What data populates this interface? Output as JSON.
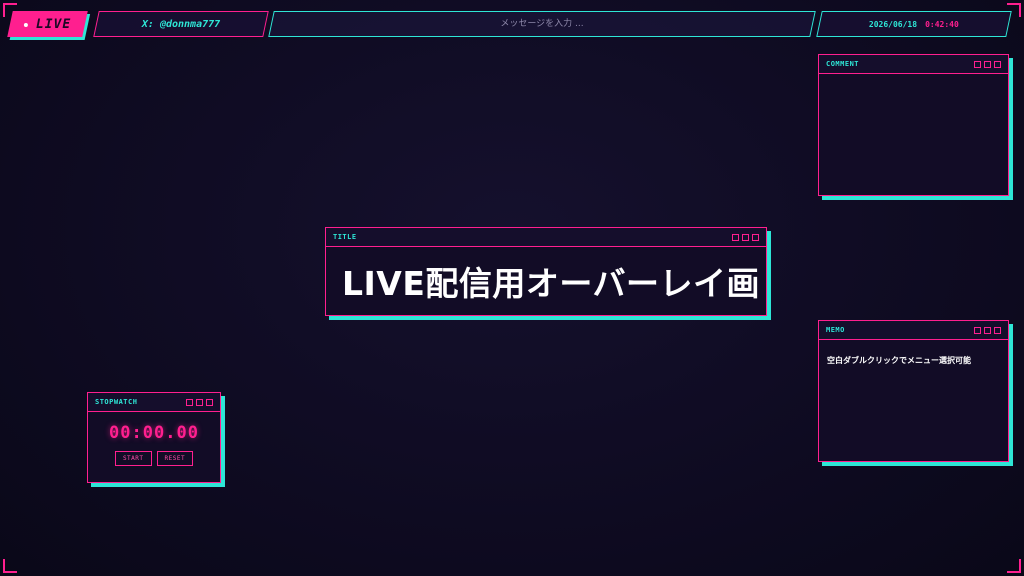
{
  "topbar": {
    "live_label": "LIVE",
    "handle": "X: @donnma777",
    "message_placeholder": "メッセージを入力 ...",
    "date": "2026/06/18",
    "time": "0:42:40"
  },
  "windows": {
    "comment": {
      "title": "COMMENT"
    },
    "title": {
      "title": "TITLE",
      "text": "LIVE配信用オーバーレイ画"
    },
    "memo": {
      "title": "MEMO",
      "text": "空白ダブルクリックでメニュー選択可能"
    },
    "stopwatch": {
      "title": "STOPWATCH",
      "display": "00:00.00",
      "start_label": "START",
      "reset_label": "RESET"
    }
  },
  "colors": {
    "background": "#0d0a1f",
    "accent_pink": "#ff1f8f",
    "accent_cyan": "#2ee6d6",
    "window_bg": "#120c26"
  }
}
